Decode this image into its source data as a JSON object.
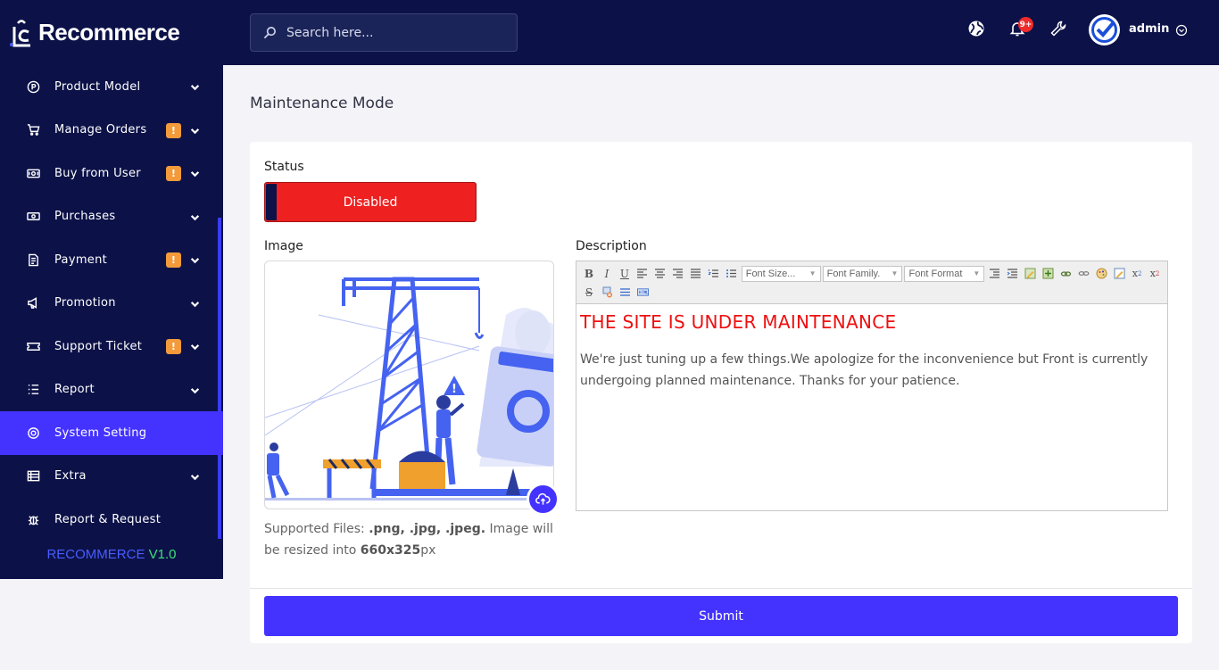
{
  "brand": {
    "name": "Recommerce"
  },
  "sidebar": {
    "items": [
      {
        "label": "Product Model",
        "icon": "product-icon",
        "chevron": true,
        "badge": ""
      },
      {
        "label": "Manage Orders",
        "icon": "cart-icon",
        "chevron": true,
        "badge": "!"
      },
      {
        "label": "Buy from User",
        "icon": "cash-icon",
        "chevron": true,
        "badge": "!"
      },
      {
        "label": "Purchases",
        "icon": "money-icon",
        "chevron": true,
        "badge": ""
      },
      {
        "label": "Payment",
        "icon": "receipt-icon",
        "chevron": true,
        "badge": "!"
      },
      {
        "label": "Promotion",
        "icon": "megaphone-icon",
        "chevron": true,
        "badge": ""
      },
      {
        "label": "Support Ticket",
        "icon": "ticket-icon",
        "chevron": true,
        "badge": "!"
      },
      {
        "label": "Report",
        "icon": "list-icon",
        "chevron": true,
        "badge": ""
      },
      {
        "label": "System Setting",
        "icon": "settings-icon",
        "chevron": false,
        "badge": "",
        "active": true
      },
      {
        "label": "Extra",
        "icon": "table-icon",
        "chevron": true,
        "badge": ""
      },
      {
        "label": "Report & Request",
        "icon": "bug-icon",
        "chevron": false,
        "badge": ""
      }
    ],
    "version_name": "RECOMMERCE",
    "version_number": "V1.0"
  },
  "topbar": {
    "search_placeholder": "Search here...",
    "notification_count": "9+",
    "user_name": "admin"
  },
  "page": {
    "title": "Maintenance Mode",
    "status_label": "Status",
    "status_value": "Disabled",
    "image_label": "Image",
    "supported_prefix": "Supported Files: ",
    "supported_types": ".png, .jpg, .jpeg.",
    "supported_mid": " Image will be resized into ",
    "supported_size": "660x325",
    "supported_unit": "px",
    "description_label": "Description",
    "editor": {
      "font_size": "Font Size...",
      "font_family": "Font Family.",
      "font_format": "Font Format",
      "heading": "THE SITE IS UNDER MAINTENANCE",
      "body": "We're just tuning up a few things.We apologize for the inconvenience but Front is currently undergoing planned maintenance. Thanks for your patience."
    },
    "submit_label": "Submit"
  },
  "colors": {
    "sidebar_bg": "#0c1248",
    "accent": "#4433ff",
    "danger": "#ee2020",
    "badge": "#f39a3b",
    "version_green": "#3ce07a"
  }
}
